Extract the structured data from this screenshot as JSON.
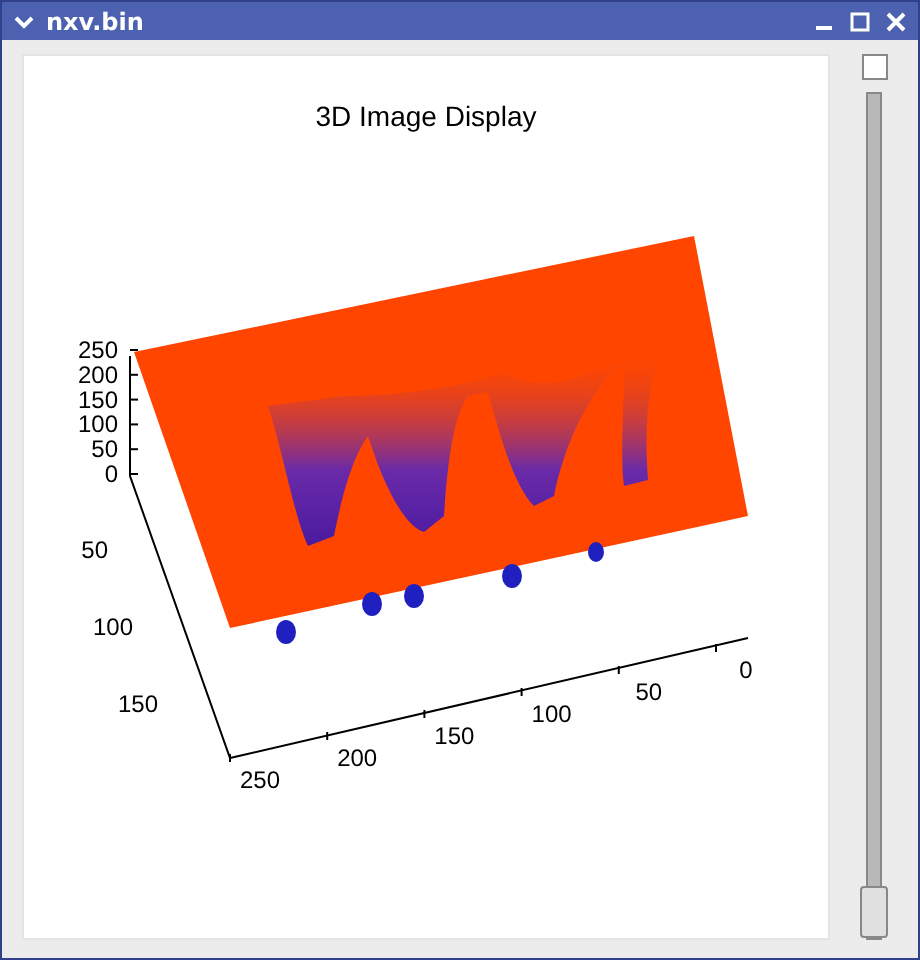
{
  "window": {
    "title": "nxv.bin"
  },
  "plot": {
    "title": "3D Image Display",
    "z_ticks": [
      "250",
      "200",
      "150",
      "100",
      "50",
      "0"
    ],
    "y_ticks": [
      "50",
      "100",
      "150"
    ],
    "x_ticks": [
      "250",
      "200",
      "150",
      "100",
      "50",
      "0"
    ]
  },
  "controls": {
    "checkbox": {
      "checked": false
    },
    "slider": {
      "level": 0
    }
  }
}
